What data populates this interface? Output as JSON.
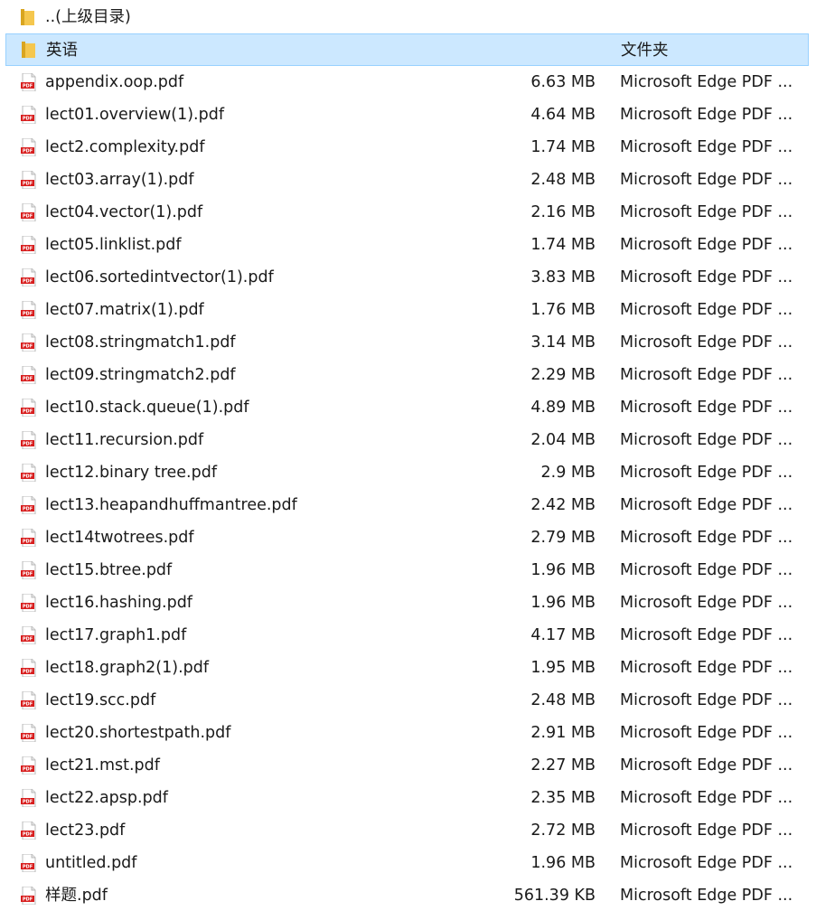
{
  "parent": {
    "label": "..(上级目录)"
  },
  "colors": {
    "selection_bg": "#cce8ff",
    "selection_border": "#99d1ff",
    "folder": "#f2c94c",
    "pdf_red": "#d81e1e"
  },
  "rows": [
    {
      "name": "英语",
      "size": "",
      "type": "文件夹",
      "icon": "folder-icon",
      "selected": true
    },
    {
      "name": "appendix.oop.pdf",
      "size": "6.63 MB",
      "type": "Microsoft Edge PDF ...",
      "icon": "pdf-icon"
    },
    {
      "name": "lect01.overview(1).pdf",
      "size": "4.64 MB",
      "type": "Microsoft Edge PDF ...",
      "icon": "pdf-icon"
    },
    {
      "name": "lect2.complexity.pdf",
      "size": "1.74 MB",
      "type": "Microsoft Edge PDF ...",
      "icon": "pdf-icon"
    },
    {
      "name": "lect03.array(1).pdf",
      "size": "2.48 MB",
      "type": "Microsoft Edge PDF ...",
      "icon": "pdf-icon"
    },
    {
      "name": "lect04.vector(1).pdf",
      "size": "2.16 MB",
      "type": "Microsoft Edge PDF ...",
      "icon": "pdf-icon"
    },
    {
      "name": "lect05.linklist.pdf",
      "size": "1.74 MB",
      "type": "Microsoft Edge PDF ...",
      "icon": "pdf-icon"
    },
    {
      "name": "lect06.sortedintvector(1).pdf",
      "size": "3.83 MB",
      "type": "Microsoft Edge PDF ...",
      "icon": "pdf-icon"
    },
    {
      "name": "lect07.matrix(1).pdf",
      "size": "1.76 MB",
      "type": "Microsoft Edge PDF ...",
      "icon": "pdf-icon"
    },
    {
      "name": "lect08.stringmatch1.pdf",
      "size": "3.14 MB",
      "type": "Microsoft Edge PDF ...",
      "icon": "pdf-icon"
    },
    {
      "name": "lect09.stringmatch2.pdf",
      "size": "2.29 MB",
      "type": "Microsoft Edge PDF ...",
      "icon": "pdf-icon"
    },
    {
      "name": "lect10.stack.queue(1).pdf",
      "size": "4.89 MB",
      "type": "Microsoft Edge PDF ...",
      "icon": "pdf-icon"
    },
    {
      "name": "lect11.recursion.pdf",
      "size": "2.04 MB",
      "type": "Microsoft Edge PDF ...",
      "icon": "pdf-icon"
    },
    {
      "name": "lect12.binary tree.pdf",
      "size": "2.9 MB",
      "type": "Microsoft Edge PDF ...",
      "icon": "pdf-icon"
    },
    {
      "name": "lect13.heapandhuffmantree.pdf",
      "size": "2.42 MB",
      "type": "Microsoft Edge PDF ...",
      "icon": "pdf-icon"
    },
    {
      "name": "lect14twotrees.pdf",
      "size": "2.79 MB",
      "type": "Microsoft Edge PDF ...",
      "icon": "pdf-icon"
    },
    {
      "name": "lect15.btree.pdf",
      "size": "1.96 MB",
      "type": "Microsoft Edge PDF ...",
      "icon": "pdf-icon"
    },
    {
      "name": "lect16.hashing.pdf",
      "size": "1.96 MB",
      "type": "Microsoft Edge PDF ...",
      "icon": "pdf-icon"
    },
    {
      "name": "lect17.graph1.pdf",
      "size": "4.17 MB",
      "type": "Microsoft Edge PDF ...",
      "icon": "pdf-icon"
    },
    {
      "name": "lect18.graph2(1).pdf",
      "size": "1.95 MB",
      "type": "Microsoft Edge PDF ...",
      "icon": "pdf-icon"
    },
    {
      "name": "lect19.scc.pdf",
      "size": "2.48 MB",
      "type": "Microsoft Edge PDF ...",
      "icon": "pdf-icon"
    },
    {
      "name": "lect20.shortestpath.pdf",
      "size": "2.91 MB",
      "type": "Microsoft Edge PDF ...",
      "icon": "pdf-icon"
    },
    {
      "name": "lect21.mst.pdf",
      "size": "2.27 MB",
      "type": "Microsoft Edge PDF ...",
      "icon": "pdf-icon"
    },
    {
      "name": "lect22.apsp.pdf",
      "size": "2.35 MB",
      "type": "Microsoft Edge PDF ...",
      "icon": "pdf-icon"
    },
    {
      "name": "lect23.pdf",
      "size": "2.72 MB",
      "type": "Microsoft Edge PDF ...",
      "icon": "pdf-icon"
    },
    {
      "name": "untitled.pdf",
      "size": "1.96 MB",
      "type": "Microsoft Edge PDF ...",
      "icon": "pdf-icon"
    },
    {
      "name": "样题.pdf",
      "size": "561.39 KB",
      "type": "Microsoft Edge PDF ...",
      "icon": "pdf-icon"
    }
  ]
}
